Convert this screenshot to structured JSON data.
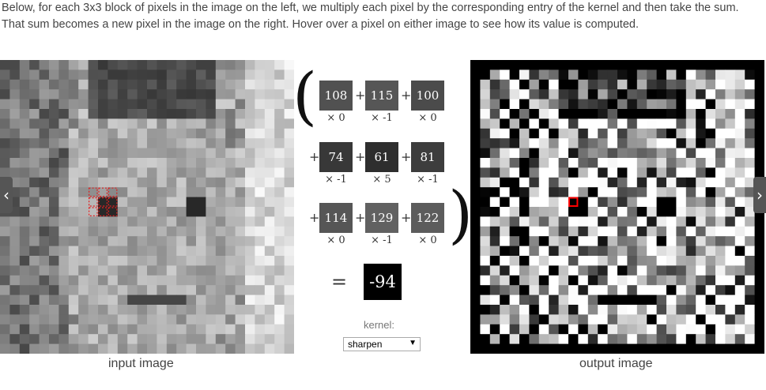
{
  "intro": "Below, for each 3x3 block of pixels in the image on the left, we multiply each pixel by the corresponding entry of the kernel and then take the sum. That sum becomes a new pixel in the image on the right. Hover over a pixel on either image to see how its value is computed.",
  "captions": {
    "input": "input image",
    "output": "output image"
  },
  "computation": {
    "rows": [
      [
        {
          "value": "108",
          "weight": "× 0"
        },
        {
          "value": "115",
          "weight": "× -1"
        },
        {
          "value": "100",
          "weight": "× 0"
        }
      ],
      [
        {
          "value": "74",
          "weight": "× -1"
        },
        {
          "value": "61",
          "weight": "× 5"
        },
        {
          "value": "81",
          "weight": "× -1"
        }
      ],
      [
        {
          "value": "114",
          "weight": "× 0"
        },
        {
          "value": "129",
          "weight": "× -1"
        },
        {
          "value": "122",
          "weight": "× 0"
        }
      ]
    ],
    "plus": "+",
    "equals": "=",
    "result": "-94",
    "open_paren": "(",
    "close_paren": ")"
  },
  "kernel": {
    "label": "kernel:",
    "selected": "sharpen",
    "arrow": "▼"
  },
  "nav": {
    "prev": "‹",
    "next": "›"
  },
  "highlight_colors": {
    "input": "#e02020",
    "output": "#ff0000"
  }
}
